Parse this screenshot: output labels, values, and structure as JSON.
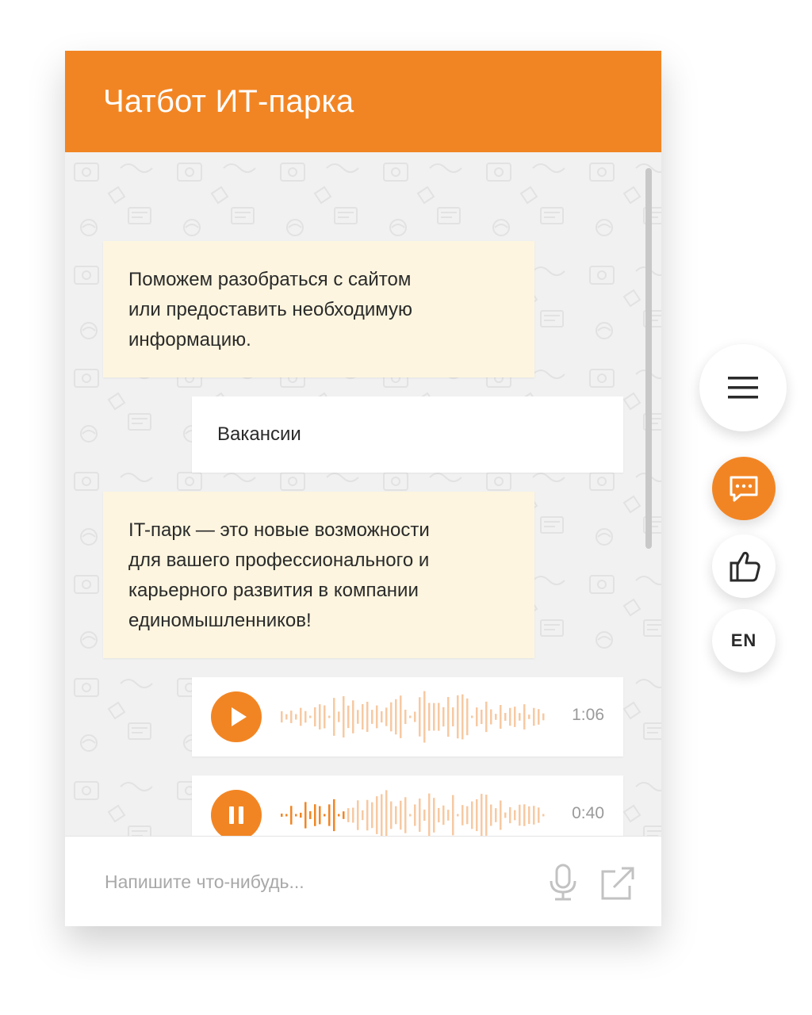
{
  "header": {
    "title": "Чатбот ИТ-парка"
  },
  "messages": [
    {
      "from": "bot",
      "lines": [
        "Поможем разобраться с сайтом",
        "или предоставить необходимую",
        "информацию."
      ]
    },
    {
      "from": "user",
      "lines": [
        "Вакансии"
      ]
    },
    {
      "from": "bot",
      "lines": [
        "IT-парк — это новые возможности",
        "для вашего профессионального и",
        "карьерного развития в компании",
        "единомышленников!"
      ]
    }
  ],
  "audio_messages": [
    {
      "state": "paused",
      "button_icon": "play-icon",
      "duration": "1:06",
      "progress": 0.0
    },
    {
      "state": "playing",
      "button_icon": "pause-icon",
      "duration": "0:40",
      "progress": 0.25
    }
  ],
  "input": {
    "placeholder": "Напишите что-нибудь...",
    "value": "",
    "mic_icon": "microphone-icon",
    "send_icon": "external-link-icon"
  },
  "side_menu": [
    {
      "name": "menu",
      "icon": "hamburger-icon",
      "active": false
    },
    {
      "name": "chat",
      "icon": "chat-bubble-icon",
      "active": true
    },
    {
      "name": "feedback",
      "icon": "thumbs-up-icon",
      "active": false
    },
    {
      "name": "language",
      "label": "EN",
      "active": false
    }
  ],
  "colors": {
    "accent": "#f28523",
    "wave_played": "#f28523",
    "wave_unplayed": "#f7c9a2",
    "bot_bubble": "#fdf5df",
    "user_bubble": "#ffffff"
  }
}
